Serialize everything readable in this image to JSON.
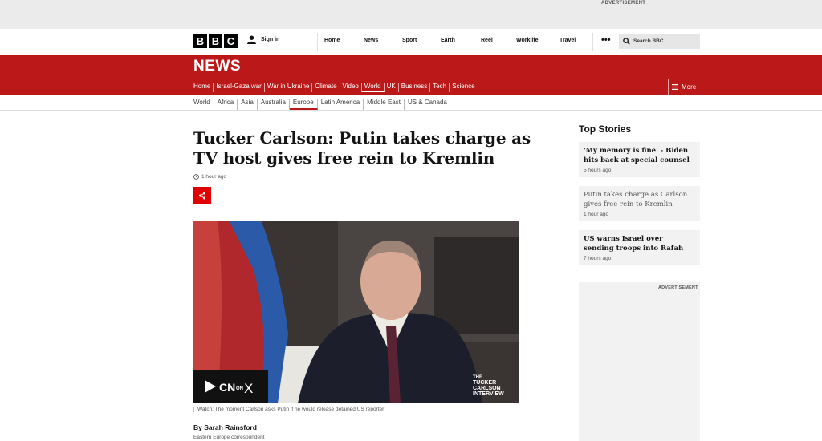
{
  "ads": {
    "top_label": "ADVERTISEMENT",
    "side_label": "ADVERTISEMENT"
  },
  "header": {
    "logo_letters": [
      "B",
      "B",
      "C"
    ],
    "sign_in": "Sign in",
    "nav": [
      "Home",
      "News",
      "Sport",
      "Earth",
      "Reel",
      "Worklife",
      "Travel"
    ],
    "more_icon": "ellipsis-icon",
    "search_label": "Search BBC"
  },
  "news_bar": {
    "title": "NEWS"
  },
  "sections": {
    "items": [
      "Home",
      "Israel-Gaza war",
      "War in Ukraine",
      "Climate",
      "Video",
      "World",
      "UK",
      "Business",
      "Tech",
      "Science"
    ],
    "active": "World",
    "more_label": "More"
  },
  "subsections": {
    "items": [
      "World",
      "Africa",
      "Asia",
      "Australia",
      "Europe",
      "Latin America",
      "Middle East",
      "US & Canada"
    ],
    "active": "Europe"
  },
  "article": {
    "headline": "Tucker Carlson: Putin takes charge as TV host gives free rein to Kremlin",
    "timestamp": "1 hour ago",
    "share_icon": "share-icon",
    "media_watermark_left": "TCN ON X",
    "media_watermark_right_lines": [
      "THE",
      "TUCKER",
      "CARLSON",
      "INTERVIEW"
    ],
    "caption": "Watch: The moment Carlson asks Putin if he would release detained US reporter",
    "byline": "By Sarah Rainsford",
    "role": "Eastern Europe correspondent"
  },
  "top_stories": {
    "title": "Top Stories",
    "items": [
      {
        "title": "'My memory is fine' - Biden hits back at special counsel",
        "time": "5 hours ago"
      },
      {
        "title": "Putin takes charge as Carlson gives free rein to Kremlin",
        "time": "1 hour ago"
      },
      {
        "title": "US warns Israel over sending troops into Rafah",
        "time": "7 hours ago"
      }
    ]
  },
  "colors": {
    "news_red": "#bb1919",
    "share_red": "#e00000"
  }
}
